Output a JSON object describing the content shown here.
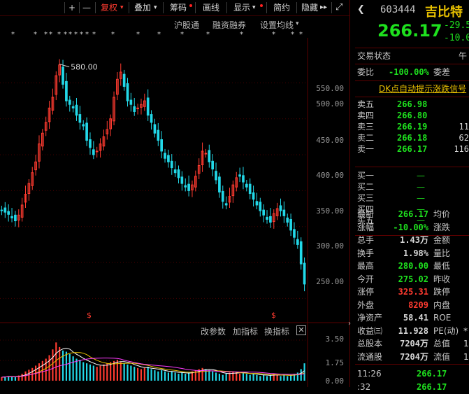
{
  "toolbar": {
    "plus": "+",
    "minus": "—",
    "fuquan": "复权",
    "diejia": "叠加",
    "chouma": "筹码",
    "huaxian": "画线",
    "xianshi": "显示",
    "jianyue": "简约",
    "yincang": "隐藏",
    "more": "▸▸",
    "expand": "⤢",
    "dropdown": "▾"
  },
  "subbar": {
    "hugutong": "沪股通",
    "rongzi": "融资融券",
    "setma": "设置均线",
    "setma_arrow": "▾"
  },
  "chart_data": {
    "type": "candlestick",
    "y_ticks": [
      "550.00",
      "500.00",
      "450.00",
      "400.00",
      "350.00",
      "300.00",
      "250.00"
    ],
    "ylim": [
      228,
      603
    ],
    "high_label": "580.00",
    "indicator_ticks": [
      "3.50",
      "1.75",
      "0.00"
    ],
    "indicator_buttons": [
      "改参数",
      "加指标",
      "换指标"
    ],
    "s_marker": "$",
    "star_marker": "*",
    "closes": [
      372,
      370,
      367,
      362,
      358,
      366,
      380,
      395,
      410,
      425,
      440,
      465,
      480,
      495,
      515,
      530,
      560,
      575,
      548,
      525,
      520,
      515,
      505,
      495,
      490,
      470,
      460,
      450,
      455,
      465,
      475,
      485,
      500,
      530,
      555,
      565,
      545,
      525,
      520,
      510,
      515,
      520,
      525,
      505,
      495,
      480,
      470,
      455,
      445,
      440,
      432,
      425,
      418,
      410,
      405,
      400,
      408,
      420,
      435,
      455,
      452,
      440,
      430,
      415,
      398,
      385,
      380,
      392,
      408,
      418,
      420,
      412,
      405,
      396,
      388,
      380,
      372,
      366,
      360,
      356,
      368,
      375,
      372,
      365,
      356,
      345,
      335,
      325,
      298,
      270
    ],
    "volumes": [
      0.3,
      0.35,
      0.4,
      0.35,
      0.3,
      0.45,
      0.6,
      0.8,
      0.95,
      1.1,
      1.3,
      1.5,
      1.7,
      1.9,
      2.2,
      2.7,
      3.3,
      2.9,
      2.6,
      2.5,
      2.3,
      2.1,
      1.9,
      1.8,
      1.6,
      1.5,
      1.4,
      1.3,
      1.2,
      1.3,
      1.4,
      1.5,
      1.6,
      1.7,
      1.8,
      1.6,
      1.5,
      1.4,
      1.3,
      1.2,
      1.1,
      1.0,
      1.1,
      1.2,
      1.0,
      0.9,
      0.8,
      0.9,
      0.8,
      0.7,
      0.8,
      0.7,
      0.6,
      0.7,
      0.6,
      0.7,
      0.8,
      0.9,
      1.0,
      1.1,
      1.0,
      0.9,
      0.8,
      0.7,
      0.6,
      0.5,
      0.6,
      0.7,
      0.8,
      0.7,
      0.6,
      0.7,
      0.6,
      0.5,
      0.6,
      0.5,
      0.4,
      0.5,
      0.4,
      0.5,
      0.6,
      0.5,
      0.4,
      0.5,
      0.4,
      0.5,
      0.6,
      0.7,
      1.0,
      1.5
    ]
  },
  "quote": {
    "code": "603444",
    "name": "吉比特",
    "price": "266.17",
    "change": "-29.5",
    "pct": "-10.0",
    "status_label": "交易状态",
    "status_value": "午",
    "weibi_label": "委比",
    "weibi_value": "-100.00%",
    "weicha_label": "委差",
    "dk_text": "DK点自动提示涨跌信号"
  },
  "asks": [
    {
      "label": "卖五",
      "price": "266.98",
      "vol": ""
    },
    {
      "label": "卖四",
      "price": "266.80",
      "vol": ""
    },
    {
      "label": "卖三",
      "price": "266.19",
      "vol": "11"
    },
    {
      "label": "卖二",
      "price": "266.18",
      "vol": "62"
    },
    {
      "label": "卖一",
      "price": "266.17",
      "vol": "116"
    }
  ],
  "bids": [
    {
      "label": "买一",
      "price": "—"
    },
    {
      "label": "买二",
      "price": "—"
    },
    {
      "label": "买三",
      "price": "—"
    },
    {
      "label": "买四",
      "price": "—"
    },
    {
      "label": "买五",
      "price": "—"
    }
  ],
  "stats": [
    {
      "l1": "最新",
      "v1": "266.17",
      "c1": "g",
      "l2": "均价"
    },
    {
      "l1": "涨幅",
      "v1": "-10.00%",
      "c1": "g",
      "l2": "涨跌"
    },
    {
      "l1": "总手",
      "v1": "1.43万",
      "c1": "w",
      "l2": "金额"
    },
    {
      "l1": "换手",
      "v1": "1.98%",
      "c1": "w",
      "l2": "量比"
    },
    {
      "l1": "最高",
      "v1": "280.00",
      "c1": "g",
      "l2": "最低"
    },
    {
      "l1": "今开",
      "v1": "275.02",
      "c1": "g",
      "l2": "昨收"
    },
    {
      "l1": "涨停",
      "v1": "325.31",
      "c1": "r",
      "l2": "跌停"
    },
    {
      "l1": "外盘",
      "v1": "8209",
      "c1": "r",
      "l2": "内盘"
    },
    {
      "l1": "净资产",
      "v1": "58.41",
      "c1": "w",
      "l2": "ROE"
    },
    {
      "l1": "收益㈢",
      "v1": "11.928",
      "c1": "w",
      "l2": "PE(动)",
      "v2": "*"
    },
    {
      "l1": "总股本",
      "v1": "7204万",
      "c1": "w",
      "l2": "总值",
      "v2": "1"
    },
    {
      "l1": "流通股",
      "v1": "7204万",
      "c1": "w",
      "l2": "流值",
      "v2": "1"
    }
  ],
  "ticks": [
    {
      "time": "11:26",
      "price": "266.17"
    },
    {
      "time": ":32",
      "price": "266.17"
    }
  ],
  "colors": {
    "up": "#ff3b30",
    "down": "#22d8e8",
    "price_down": "#1ee01e",
    "ma5": "#ffffff",
    "ma10": "#e8c000",
    "ma20": "#ff3bff"
  }
}
